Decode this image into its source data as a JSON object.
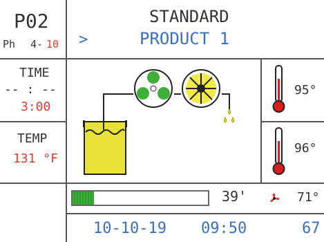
{
  "program": {
    "code": "P02",
    "phase_label": "Ph",
    "phase_current": "4-",
    "phase_total": "10"
  },
  "header": {
    "title": "STANDARD",
    "product": "PRODUCT 1",
    "arrow": ">"
  },
  "time": {
    "label": "TIME",
    "elapsed": "-- : --",
    "set": "3:00"
  },
  "temp": {
    "label": "TEMP",
    "value": "131 °F"
  },
  "sensors": [
    {
      "value": "95°"
    },
    {
      "value": "96°"
    }
  ],
  "progress": {
    "fraction": 0.16,
    "label": "39'"
  },
  "fan": {
    "value": "71°"
  },
  "footer": {
    "date": "10-10-19",
    "clock": "09:50",
    "extra": "67"
  },
  "colors": {
    "accent_blue": "#3a6fbf",
    "alert_red": "#e23b2e",
    "fan_green": "#3fae3a",
    "tank_yellow": "#e8e23a",
    "progress_green": "#3fae3a"
  },
  "icons": [
    "thermometer-icon",
    "fan-icon",
    "pump-icon",
    "heater-icon",
    "tank-icon",
    "drip-icon",
    "chevron-right-icon"
  ]
}
